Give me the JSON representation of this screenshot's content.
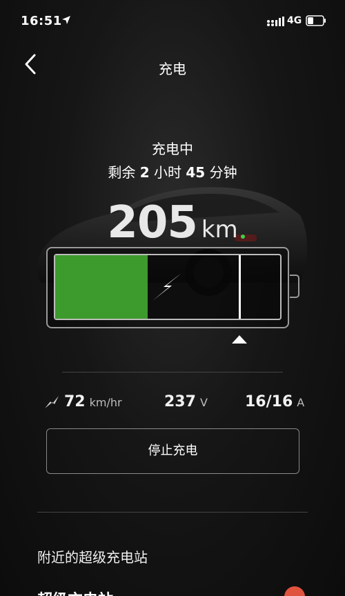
{
  "status_bar": {
    "time": "16:51",
    "network": "4G"
  },
  "nav": {
    "title": "充电"
  },
  "charging": {
    "state": "充电中",
    "remaining_prefix": "剩余",
    "hours": "2",
    "hours_unit": "小时",
    "minutes": "45",
    "minutes_unit": "分钟",
    "range_value": "205",
    "range_unit": "km",
    "battery_level": 0.41,
    "charge_limit": 0.82,
    "fill_color": "#3d9a2c"
  },
  "stats": {
    "speed_value": "72",
    "speed_unit": "km/hr",
    "voltage_value": "237",
    "voltage_unit": "V",
    "current_value": "16/16",
    "current_unit": "A"
  },
  "actions": {
    "stop_label": "停止充电"
  },
  "superchargers": {
    "title": "附近的超级充电站",
    "first_item": "超级充电站"
  }
}
